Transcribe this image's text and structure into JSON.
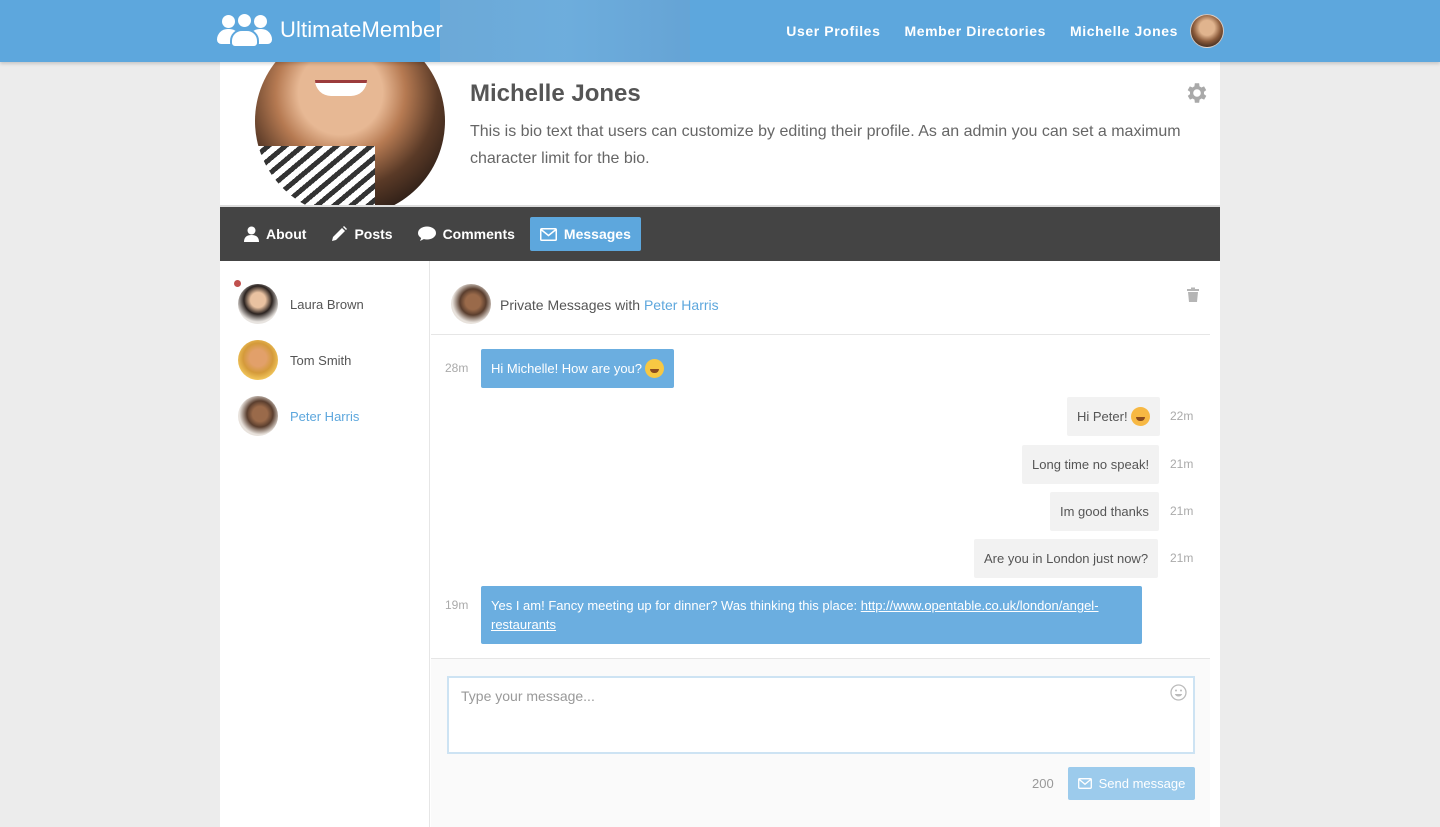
{
  "brand": {
    "name": "UltimateMember",
    "color": "#5da7dd"
  },
  "nav": {
    "links": [
      "User Profiles",
      "Member Directories",
      "Michelle Jones"
    ]
  },
  "profile": {
    "name": "Michelle Jones",
    "bio": "This is bio text that users can customize by editing their profile. As an admin you can set a maximum character limit for the bio."
  },
  "tabs": [
    {
      "label": "About",
      "icon": "user-icon"
    },
    {
      "label": "Posts",
      "icon": "pencil-icon"
    },
    {
      "label": "Comments",
      "icon": "comment-icon"
    },
    {
      "label": "Messages",
      "icon": "envelope-icon",
      "active": true
    }
  ],
  "conversations": [
    {
      "name": "Laura Brown",
      "unread": true,
      "unread_color": "#c0504d"
    },
    {
      "name": "Tom Smith",
      "unread": false
    },
    {
      "name": "Peter Harris",
      "unread": false,
      "active": true
    }
  ],
  "thread": {
    "title_prefix": "Private Messages with",
    "with": "Peter Harris",
    "messages": [
      {
        "dir": "in",
        "text": "Hi Michelle! How are you?",
        "emoji": "grinning-emoji",
        "time": "28m"
      },
      {
        "dir": "out",
        "text": "Hi Peter!",
        "emoji": "winking-tongue-emoji",
        "time": "22m"
      },
      {
        "dir": "out",
        "text": "Long time no speak!",
        "time": "21m"
      },
      {
        "dir": "out",
        "text": "Im good thanks",
        "time": "21m"
      },
      {
        "dir": "out",
        "text": "Are you in London just now?",
        "time": "21m"
      },
      {
        "dir": "in",
        "text": "Yes I am! Fancy meeting up for dinner? Was thinking this place:",
        "link": "http://www.opentable.co.uk/london/angel-restaurants",
        "time": "19m"
      }
    ]
  },
  "composer": {
    "placeholder": "Type your message...",
    "char_limit": "200",
    "send_label": "Send message"
  }
}
